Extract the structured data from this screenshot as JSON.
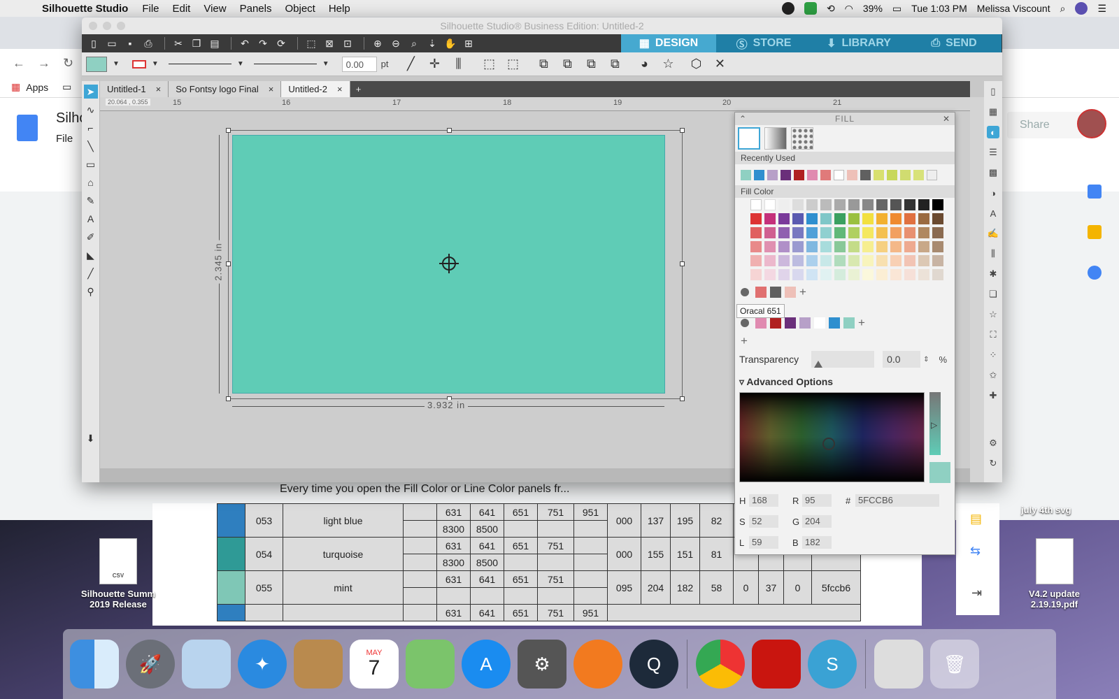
{
  "menubar": {
    "app": "Silhouette Studio",
    "menus": [
      "File",
      "Edit",
      "View",
      "Panels",
      "Object",
      "Help"
    ],
    "battery": "39%",
    "clock": "Tue 1:03 PM",
    "user": "Melissa Viscount"
  },
  "chrome": {
    "bookmarks_apps": "Apps",
    "docs_title": "Silho",
    "docs_menu": "File",
    "share": "Share",
    "doc_text_line": "Every time you open the Fill Color or Line Color panels fr..."
  },
  "silhouette": {
    "window_title": "Silhouette Studio® Business Edition: Untitled-2",
    "modes": [
      "DESIGN",
      "STORE",
      "LIBRARY",
      "SEND"
    ],
    "line_width": "0.00",
    "line_unit": "pt",
    "doc_tabs": [
      "Untitled-1",
      "So Fontsy logo Final",
      "Untitled-2"
    ],
    "coord_readout": "20.064 , 0.355",
    "ruler_labels": [
      "15",
      "16",
      "17",
      "18",
      "19",
      "20",
      "21"
    ],
    "shape_width": "3.932 in",
    "shape_height": "2.345 in",
    "shape_color": "#5fccb6"
  },
  "fill_panel": {
    "title": "FILL",
    "recently_used_label": "Recently Used",
    "recently_used": [
      "#8fd0c2",
      "#2f8fcf",
      "#b7a0c8",
      "#6a2f7a",
      "#b02020",
      "#e08ab0",
      "#e07a7a",
      "none",
      "#eec0b8",
      "#606060",
      "#d8e070",
      "#c8d85a",
      "#d0dc70",
      "#d8e27a",
      "picker"
    ],
    "fill_color_label": "Fill Color",
    "tooltip": "Oracal 651",
    "transparency_label": "Transparency",
    "transparency_value": "0.0",
    "transparency_unit": "%",
    "advanced_label": "Advanced Options",
    "readouts": {
      "H": "168",
      "S": "52",
      "L": "59",
      "R": "95",
      "G": "204",
      "B": "182",
      "hex_label": "#",
      "hex": "5FCCB6"
    }
  },
  "sheet": {
    "rows": [
      {
        "num": "053",
        "name": "light blue",
        "codes_top": [
          "631",
          "641",
          "651",
          "751",
          "951"
        ],
        "codes_bottom": [
          "8300",
          "8500",
          "",
          "",
          ""
        ],
        "rgb": [
          "000",
          "137",
          "195"
        ],
        "extra": "82",
        "color": "#2f7fbf"
      },
      {
        "num": "054",
        "name": "turquoise",
        "codes_top": [
          "631",
          "641",
          "651",
          "751",
          ""
        ],
        "codes_bottom": [
          "8300",
          "8500",
          "",
          "",
          ""
        ],
        "rgb": [
          "000",
          "155",
          "151"
        ],
        "extra": "81",
        "color": "#2f9a96"
      },
      {
        "num": "055",
        "name": "mint",
        "codes_top": [
          "631",
          "641",
          "651",
          "751",
          ""
        ],
        "codes_bottom": [
          "",
          "",
          "",
          "",
          ""
        ],
        "rgb": [
          "095",
          "204",
          "182"
        ],
        "extra": "58",
        "cmyk_rest": [
          "0",
          "37",
          "0"
        ],
        "hex": "5fccb6",
        "color": "#7fc7b6"
      }
    ],
    "partial_row": [
      "631",
      "641",
      "651",
      "751",
      "951"
    ]
  },
  "desktop": {
    "file1_label": "Silhouette Summ 2019 Release",
    "file1_ext": "CSV",
    "file2_label": "V4.2 update 2.19.19.pdf",
    "folder_label": "july 4th svg"
  },
  "dock": {
    "items": [
      "Finder",
      "Launchpad",
      "Mail",
      "Safari",
      "Contacts",
      "Calendar",
      "Maps",
      "App Store",
      "System Preferences",
      "Firefox",
      "QuickTime",
      "Chrome",
      "Acrobat",
      "Silhouette Studio",
      "Photo",
      "Trash"
    ],
    "calendar_month": "MAY",
    "calendar_day": "7"
  }
}
